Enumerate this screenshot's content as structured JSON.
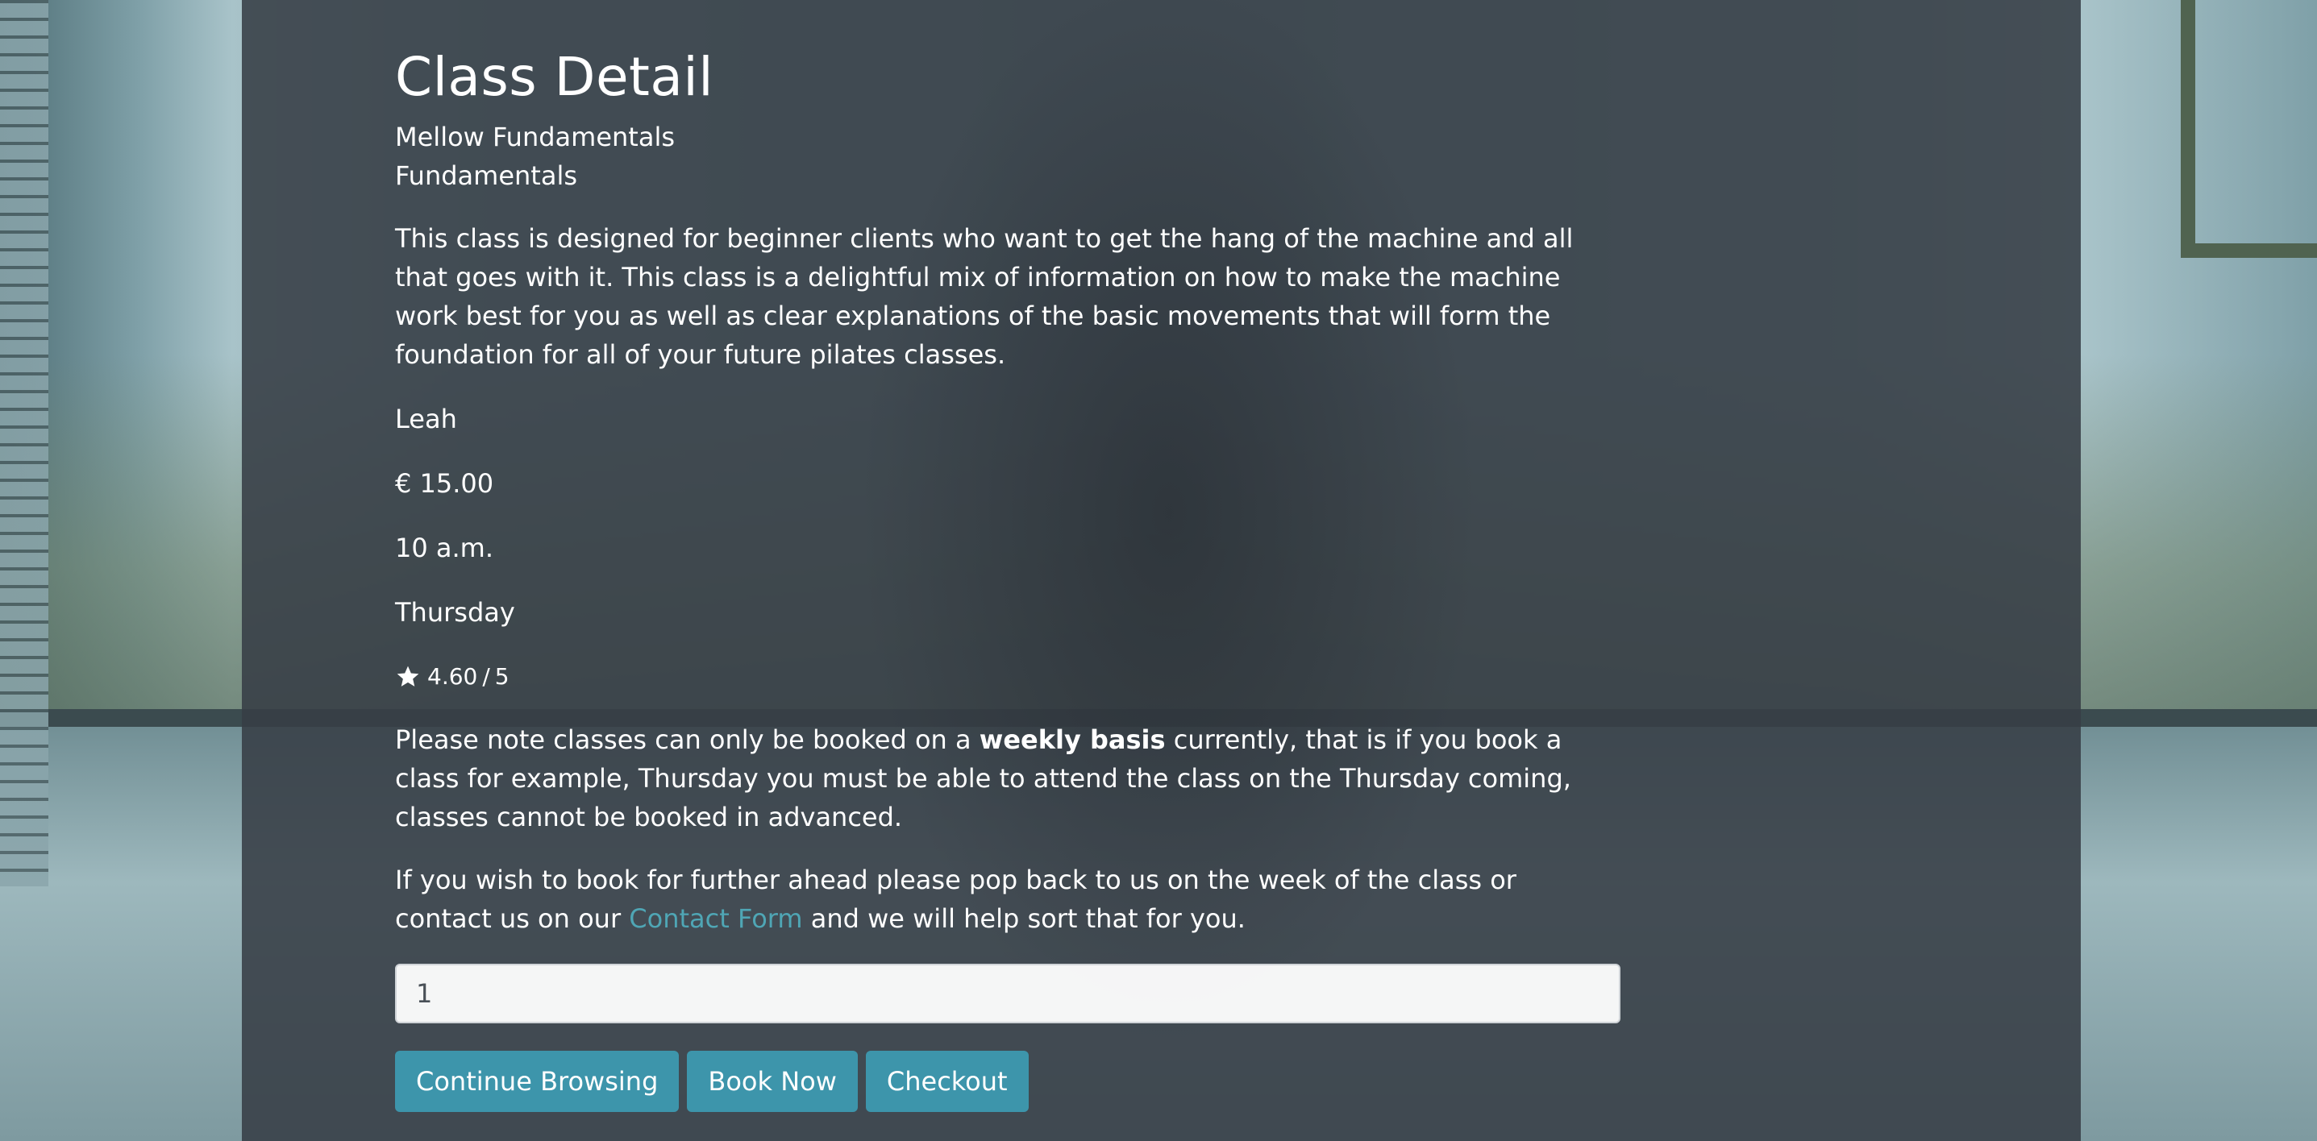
{
  "class_detail": {
    "page_title": "Class Detail",
    "class_name": "Mellow Fundamentals",
    "category": "Fundamentals",
    "description": "This class is designed for beginner clients who want to get the hang of the machine and all that goes with it. This class is a delightful mix of information on how to make the machine work best for you as well as clear explanations of the basic movements that will form the foundation for all of your future pilates classes.",
    "instructor": "Leah",
    "price": "€ 15.00",
    "time": "10 a.m.",
    "day": "Thursday",
    "rating": {
      "icon": "star-icon",
      "value": "4.60",
      "separator": "/",
      "max": "5"
    }
  },
  "booking_note": {
    "part1": "Please note classes can only be booked on a ",
    "bold": "weekly basis",
    "part2": " currently, that is if you book a class for example, Thursday you must be able to attend the class on the Thursday coming, classes cannot be booked in advanced."
  },
  "further_note": {
    "part1": "If you wish to book for further ahead please pop back to us on the week of the class or contact us on our ",
    "link_label": "Contact Form",
    "part2": " and we will help sort that for you."
  },
  "form": {
    "quantity_value": "1"
  },
  "buttons": {
    "continue_browsing": "Continue Browsing",
    "book_now": "Book Now",
    "checkout": "Checkout"
  },
  "colors": {
    "button_bg": "#3d95ab",
    "link": "#4fa6b5",
    "panel_bg": "#373e46"
  }
}
